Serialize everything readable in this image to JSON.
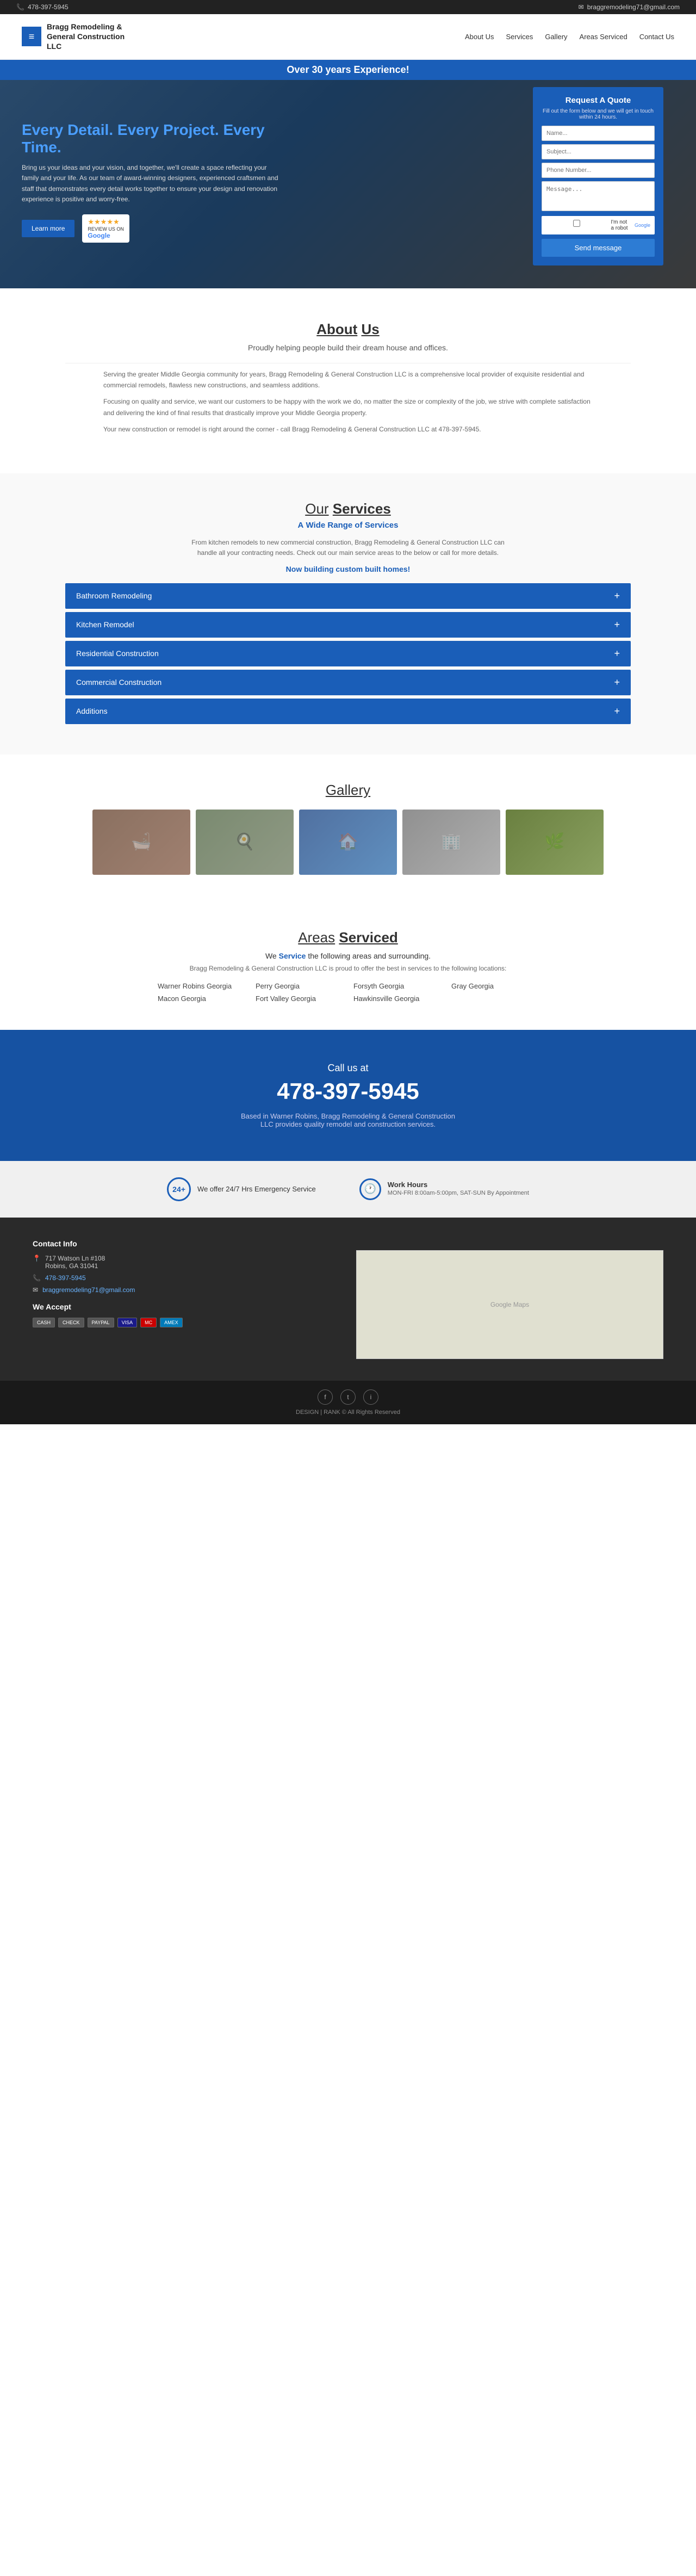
{
  "topbar": {
    "phone": "478-397-5945",
    "email": "braggremodeling71@gmail.com"
  },
  "header": {
    "logo_line1": "Bragg Remodeling &",
    "logo_line2": "General Construction",
    "logo_line3": "LLC",
    "nav": [
      {
        "label": "About Us",
        "id": "about"
      },
      {
        "label": "Services",
        "id": "services"
      },
      {
        "label": "Gallery",
        "id": "gallery"
      },
      {
        "label": "Areas Serviced",
        "id": "areas"
      },
      {
        "label": "Contact Us",
        "id": "contact"
      }
    ]
  },
  "hero": {
    "experience_bar": "Over 30 years Experience!",
    "headline_bold": "Every Detail.",
    "headline_rest": " Every Project. Every Time.",
    "description": "Bring us your ideas and your vision, and together, we'll create a space reflecting your family and your life. As our team of award-winning designers, experienced craftsmen and staff that demonstrates every detail works together to ensure your design and renovation experience is positive and worry-free.",
    "learn_more": "Learn more",
    "google_reviews": "REVIEW US ON",
    "google_brand": "Google",
    "stars": "★★★★★",
    "quote_form": {
      "title": "Request A Quote",
      "subtitle": "Fill out the form below and we will get in touch within 24 hours.",
      "name_placeholder": "Name...",
      "subject_placeholder": "Subject...",
      "phone_placeholder": "Phone Number...",
      "message_placeholder": "Message...",
      "robot_label": "I'm not a robot",
      "send_label": "Send message"
    }
  },
  "about": {
    "heading": "About",
    "heading_underline": "Us",
    "subtitle": "Proudly helping people build their dream house and offices.",
    "paragraphs": [
      "Serving the greater Middle Georgia community for years, Bragg Remodeling & General Construction LLC is a comprehensive local provider of exquisite residential and commercial remodels, flawless new constructions, and seamless additions.",
      "Focusing on quality and service, we want our customers to be happy with the work we do, no matter the size or complexity of the job, we strive with complete satisfaction and delivering the kind of final results that drastically improve your Middle Georgia property.",
      "Your new construction or remodel is right around the corner - call Bragg Remodeling & General Construction LLC at 478-397-5945."
    ]
  },
  "services": {
    "heading": "Our",
    "heading_underline": "Services",
    "wide_range_prefix": "A",
    "wide_range_bold": "Wide Range",
    "wide_range_suffix": "of Services",
    "description": "From kitchen remodels to new commercial construction, Bragg Remodeling & General Construction LLC can handle all your contracting needs. Check out our main service areas to the below or call for more details.",
    "custom_homes": "Now building custom built homes!",
    "items": [
      {
        "label": "Bathroom Remodeling",
        "id": "bathroom"
      },
      {
        "label": "Kitchen Remodel",
        "id": "kitchen"
      },
      {
        "label": "Residential Construction",
        "id": "residential"
      },
      {
        "label": "Commercial Construction",
        "id": "commercial"
      },
      {
        "label": "Additions",
        "id": "additions"
      }
    ]
  },
  "gallery": {
    "heading": "Gallery",
    "images": [
      {
        "alt": "Bathroom remodel",
        "type": "bathroom"
      },
      {
        "alt": "Kitchen remodel",
        "type": "kitchen"
      },
      {
        "alt": "House construction",
        "type": "house"
      },
      {
        "alt": "Office interior",
        "type": "office"
      },
      {
        "alt": "Outdoor space",
        "type": "outdoor"
      }
    ]
  },
  "areas": {
    "heading": "Areas",
    "heading_underline": "Serviced",
    "subtitle_prefix": "We",
    "subtitle_bold": "Service",
    "subtitle_suffix": "the following areas and surrounding.",
    "description": "Bragg Remodeling & General Construction LLC is proud to offer the best in services to the following locations:",
    "locations": [
      "Warner Robins Georgia",
      "Perry Georgia",
      "Forsyth Georgia",
      "Gray Georgia",
      "Macon Georgia",
      "Fort Valley Georgia",
      "Hawkinsville Georgia"
    ]
  },
  "cta": {
    "call_us": "Call us at",
    "phone": "478-397-5945",
    "description": "Based in Warner Robins, Bragg Remodeling & General Construction LLC provides quality remodel and construction services."
  },
  "service_hours": {
    "emergency_label": "We offer 24/7 Hrs Emergency Service",
    "work_hours_label": "Work Hours",
    "work_hours_detail": "MON-FRI 8:00am-5:00pm, SAT-SUN By Appointment"
  },
  "footer": {
    "contact_heading": "Contact Info",
    "address": "717 Watson Ln #108",
    "city": "Robins, GA 31041",
    "phone": "478-397-5945",
    "email": "braggremodeling71@gmail.com",
    "accept_heading": "We Accept",
    "payment_methods": [
      "CASH",
      "CHECK",
      "PAYPAL",
      "VISA",
      "MC",
      "AMEX"
    ],
    "map_placeholder": "Google Maps"
  },
  "footer_bottom": {
    "social_icons": [
      "f",
      "t",
      "i"
    ],
    "copyright": "DESIGN | RANK © All Rights Reserved"
  }
}
